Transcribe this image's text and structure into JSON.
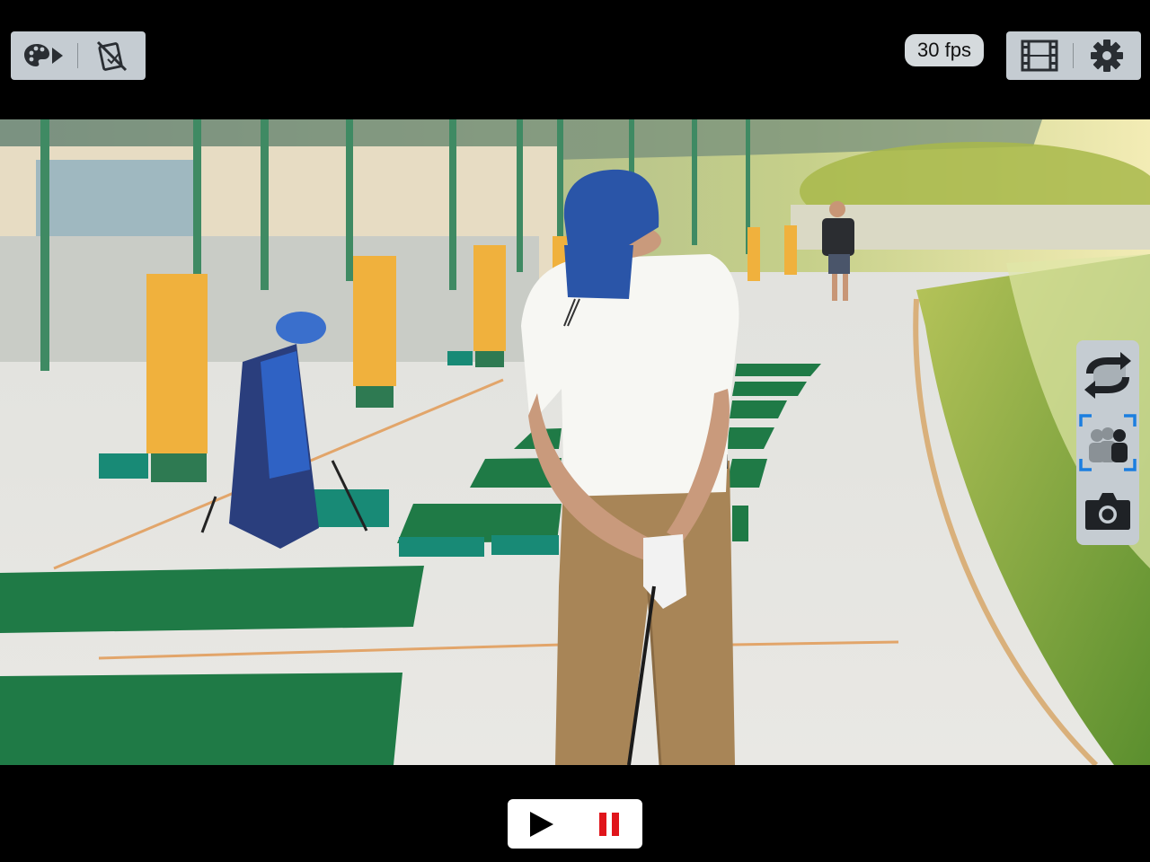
{
  "top_left_toolbar": {
    "icons": [
      "palette-play-icon",
      "no-phone-icon"
    ]
  },
  "fps": {
    "label": "30 fps"
  },
  "top_right_toolbar": {
    "icons": [
      "film-strip-icon",
      "gear-icon"
    ]
  },
  "side_panel": {
    "icons": [
      "switch-camera-icon",
      "people-focus-icon",
      "camera-icon"
    ],
    "focus_color": "#1c7ee0"
  },
  "playback": {
    "icons": [
      "play-icon",
      "pause-icon"
    ],
    "pause_color": "#e0151b"
  }
}
